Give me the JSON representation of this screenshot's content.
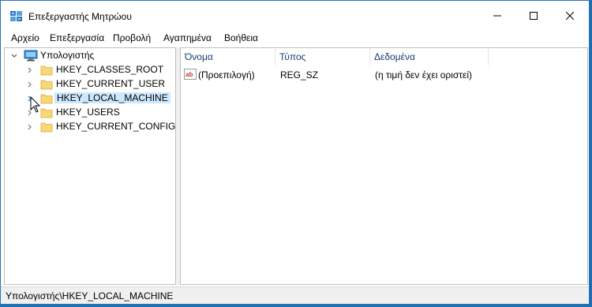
{
  "window": {
    "title": "Επεξεργαστής Μητρώου"
  },
  "menu": [
    "Αρχείο",
    "Επεξεργασία",
    "Προβολή",
    "Αγαπημένα",
    "Βοήθεια"
  ],
  "tree": {
    "root": "Υπολογιστής",
    "items": [
      {
        "label": "HKEY_CLASSES_ROOT",
        "selected": false
      },
      {
        "label": "HKEY_CURRENT_USER",
        "selected": false
      },
      {
        "label": "HKEY_LOCAL_MACHINE",
        "selected": true
      },
      {
        "label": "HKEY_USERS",
        "selected": false
      },
      {
        "label": "HKEY_CURRENT_CONFIG",
        "selected": false
      }
    ]
  },
  "list": {
    "columns": [
      "Όνομα",
      "Τύπος",
      "Δεδομένα"
    ],
    "rows": [
      {
        "name": "(Προεπιλογή)",
        "type": "REG_SZ",
        "data": "(η τιμή δεν έχει οριστεί)",
        "icon": "string-value-icon"
      }
    ]
  },
  "status": {
    "path": "Υπολογιστής\\HKEY_LOCAL_MACHINE"
  },
  "colors": {
    "selection": "#cce8ff",
    "header_text": "#1a3c6e",
    "window_border": "#2b73b8",
    "desktop": "#1b6fb3"
  }
}
